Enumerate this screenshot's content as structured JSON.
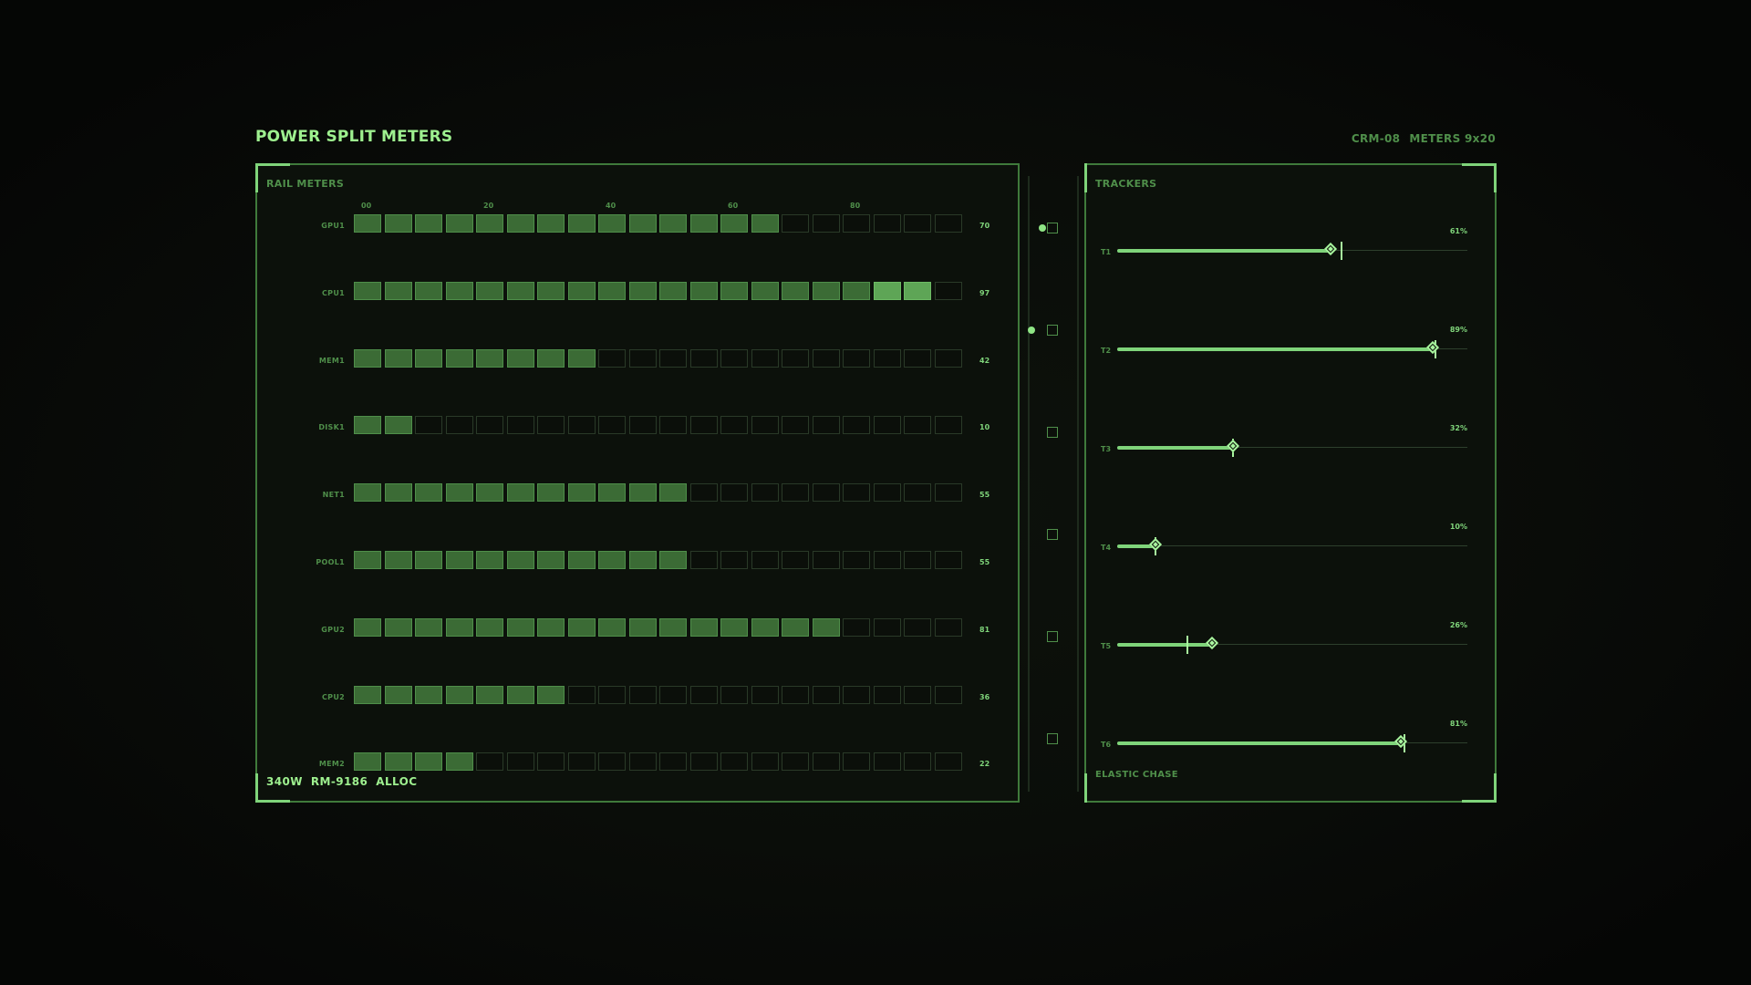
{
  "header": {
    "title": "POWER SPLIT METERS",
    "device_id": "CRM-08",
    "mode": "METERS 9x20"
  },
  "rail_meters": {
    "label": "RAIL METERS",
    "scale_labels": [
      "00",
      "20",
      "40",
      "60",
      "80"
    ],
    "cells_per_row": 20,
    "rows": [
      {
        "name": "GPU1",
        "value": 70,
        "lit": 14,
        "peak": 0
      },
      {
        "name": "CPU1",
        "value": 97,
        "lit": 19,
        "peak": 2
      },
      {
        "name": "MEM1",
        "value": 42,
        "lit": 8,
        "peak": 0
      },
      {
        "name": "DISK1",
        "value": 10,
        "lit": 2,
        "peak": 0
      },
      {
        "name": "NET1",
        "value": 55,
        "lit": 11,
        "peak": 0
      },
      {
        "name": "POOL1",
        "value": 55,
        "lit": 11,
        "peak": 0
      },
      {
        "name": "GPU2",
        "value": 81,
        "lit": 16,
        "peak": 0
      },
      {
        "name": "CPU2",
        "value": 36,
        "lit": 7,
        "peak": 0
      },
      {
        "name": "MEM2",
        "value": 22,
        "lit": 4,
        "peak": 0
      }
    ],
    "footer": [
      "340W",
      "RM-9186",
      "ALLOC"
    ]
  },
  "channel_strip": {
    "channels": [
      {
        "dot": true
      },
      {
        "dot": true
      },
      {
        "dot": false
      },
      {
        "dot": false
      },
      {
        "dot": false
      },
      {
        "dot": false
      }
    ]
  },
  "trackers": {
    "label": "TRACKERS",
    "footer": "ELASTIC CHASE",
    "items": [
      {
        "name": "T1",
        "pct_label": "61%",
        "value": 0.61,
        "target": 0.64
      },
      {
        "name": "T2",
        "pct_label": "89%",
        "value": 0.9,
        "target": 0.91
      },
      {
        "name": "T3",
        "pct_label": "32%",
        "value": 0.33,
        "target": 0.33
      },
      {
        "name": "T4",
        "pct_label": "10%",
        "value": 0.11,
        "target": 0.11
      },
      {
        "name": "T5",
        "pct_label": "26%",
        "value": 0.27,
        "target": 0.2
      },
      {
        "name": "T6",
        "pct_label": "81%",
        "value": 0.81,
        "target": 0.82
      }
    ]
  },
  "colors": {
    "accent": "#7fd47a",
    "accent_bright": "#a8f59e",
    "dim": "#4f8f4a",
    "cell_on": "#3b6b35",
    "cell_peak": "#5ea556",
    "panel_bg": "#0c110b"
  }
}
